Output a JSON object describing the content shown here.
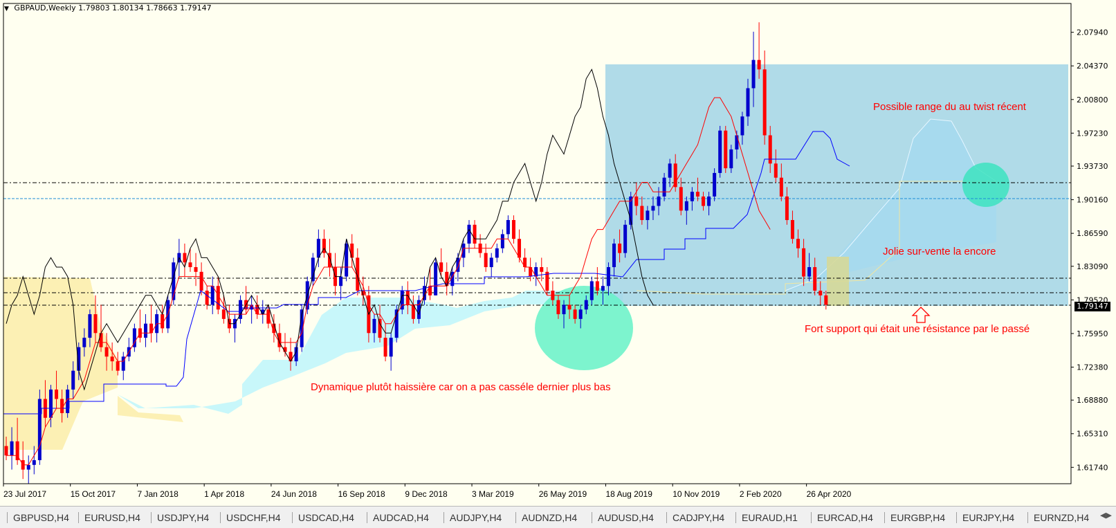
{
  "title": {
    "symbol": "GBPAUD,Weekly",
    "ohlc": "1.79803 1.80134 1.78663 1.79147"
  },
  "current_price": "1.79147",
  "price_axis": {
    "labels": [
      "2.07940",
      "2.04370",
      "2.00800",
      "1.97230",
      "1.93730",
      "1.90160",
      "1.86590",
      "1.83090",
      "1.79520",
      "1.75950",
      "1.72380",
      "1.68880",
      "1.65310",
      "1.61740"
    ],
    "ylim": [
      1.6,
      2.11
    ]
  },
  "time_axis": {
    "labels": [
      "23 Jul 2017",
      "15 Oct 2017",
      "7 Jan 2018",
      "1 Apr 2018",
      "24 Jun 2018",
      "16 Sep 2018",
      "9 Dec 2018",
      "3 Mar 2019",
      "26 May 2019",
      "18 Aug 2019",
      "10 Nov 2019",
      "2 Feb 2020",
      "26 Apr 2020"
    ],
    "label_bar_index": [
      0,
      12,
      24,
      36,
      48,
      60,
      72,
      84,
      96,
      108,
      120,
      132,
      144
    ]
  },
  "annotations": {
    "range_twist": "Possible range du au twist récent",
    "oversold": "Jolie sur-vente la encore",
    "support": "Fort support qui était une résistance par le passé",
    "dynamic": "Dynamique plutôt haissière car on a pas casséle dernier plus bas"
  },
  "chart_data": {
    "type": "candlestick",
    "ylim": [
      1.6,
      2.11
    ],
    "candles_ohlc": [
      [
        1.64,
        1.65,
        1.625,
        1.63
      ],
      [
        1.63,
        1.66,
        1.615,
        1.645
      ],
      [
        1.645,
        1.67,
        1.62,
        1.625
      ],
      [
        1.625,
        1.645,
        1.605,
        1.615
      ],
      [
        1.615,
        1.63,
        1.6,
        1.62
      ],
      [
        1.62,
        1.64,
        1.61,
        1.625
      ],
      [
        1.625,
        1.7,
        1.62,
        1.69
      ],
      [
        1.69,
        1.71,
        1.66,
        1.67
      ],
      [
        1.67,
        1.705,
        1.66,
        1.7
      ],
      [
        1.7,
        1.72,
        1.68,
        1.69
      ],
      [
        1.69,
        1.7,
        1.665,
        1.675
      ],
      [
        1.675,
        1.705,
        1.67,
        1.7
      ],
      [
        1.7,
        1.73,
        1.69,
        1.72
      ],
      [
        1.72,
        1.75,
        1.71,
        1.745
      ],
      [
        1.745,
        1.765,
        1.735,
        1.755
      ],
      [
        1.755,
        1.785,
        1.745,
        1.78
      ],
      [
        1.78,
        1.8,
        1.75,
        1.76
      ],
      [
        1.76,
        1.79,
        1.74,
        1.745
      ],
      [
        1.745,
        1.76,
        1.72,
        1.735
      ],
      [
        1.735,
        1.75,
        1.72,
        1.73
      ],
      [
        1.73,
        1.74,
        1.715,
        1.72
      ],
      [
        1.72,
        1.74,
        1.71,
        1.735
      ],
      [
        1.735,
        1.755,
        1.73,
        1.745
      ],
      [
        1.745,
        1.77,
        1.74,
        1.765
      ],
      [
        1.765,
        1.785,
        1.75,
        1.755
      ],
      [
        1.755,
        1.78,
        1.745,
        1.77
      ],
      [
        1.77,
        1.79,
        1.75,
        1.76
      ],
      [
        1.76,
        1.785,
        1.75,
        1.78
      ],
      [
        1.78,
        1.79,
        1.76,
        1.765
      ],
      [
        1.765,
        1.8,
        1.76,
        1.795
      ],
      [
        1.795,
        1.84,
        1.79,
        1.835
      ],
      [
        1.835,
        1.86,
        1.82,
        1.845
      ],
      [
        1.845,
        1.855,
        1.82,
        1.835
      ],
      [
        1.835,
        1.85,
        1.825,
        1.83
      ],
      [
        1.83,
        1.845,
        1.81,
        1.825
      ],
      [
        1.825,
        1.835,
        1.8,
        1.805
      ],
      [
        1.805,
        1.81,
        1.785,
        1.79
      ],
      [
        1.79,
        1.82,
        1.78,
        1.81
      ],
      [
        1.81,
        1.82,
        1.78,
        1.785
      ],
      [
        1.785,
        1.8,
        1.77,
        1.775
      ],
      [
        1.775,
        1.79,
        1.76,
        1.765
      ],
      [
        1.765,
        1.78,
        1.75,
        1.775
      ],
      [
        1.775,
        1.8,
        1.77,
        1.795
      ],
      [
        1.795,
        1.81,
        1.78,
        1.785
      ],
      [
        1.785,
        1.8,
        1.77,
        1.79
      ],
      [
        1.79,
        1.8,
        1.775,
        1.78
      ],
      [
        1.78,
        1.795,
        1.77,
        1.785
      ],
      [
        1.785,
        1.79,
        1.765,
        1.77
      ],
      [
        1.77,
        1.78,
        1.75,
        1.76
      ],
      [
        1.76,
        1.77,
        1.74,
        1.745
      ],
      [
        1.745,
        1.76,
        1.735,
        1.74
      ],
      [
        1.74,
        1.755,
        1.72,
        1.73
      ],
      [
        1.73,
        1.75,
        1.725,
        1.745
      ],
      [
        1.745,
        1.79,
        1.74,
        1.785
      ],
      [
        1.785,
        1.82,
        1.78,
        1.815
      ],
      [
        1.815,
        1.845,
        1.81,
        1.84
      ],
      [
        1.84,
        1.87,
        1.83,
        1.86
      ],
      [
        1.86,
        1.87,
        1.84,
        1.845
      ],
      [
        1.845,
        1.86,
        1.82,
        1.83
      ],
      [
        1.83,
        1.845,
        1.8,
        1.81
      ],
      [
        1.81,
        1.83,
        1.795,
        1.82
      ],
      [
        1.82,
        1.86,
        1.815,
        1.855
      ],
      [
        1.855,
        1.865,
        1.83,
        1.84
      ],
      [
        1.84,
        1.85,
        1.8,
        1.805
      ],
      [
        1.805,
        1.82,
        1.79,
        1.8
      ],
      [
        1.8,
        1.81,
        1.75,
        1.76
      ],
      [
        1.76,
        1.78,
        1.75,
        1.775
      ],
      [
        1.775,
        1.79,
        1.75,
        1.755
      ],
      [
        1.755,
        1.77,
        1.73,
        1.735
      ],
      [
        1.735,
        1.76,
        1.72,
        1.755
      ],
      [
        1.755,
        1.79,
        1.75,
        1.785
      ],
      [
        1.785,
        1.81,
        1.78,
        1.805
      ],
      [
        1.805,
        1.815,
        1.78,
        1.79
      ],
      [
        1.79,
        1.8,
        1.77,
        1.775
      ],
      [
        1.775,
        1.8,
        1.77,
        1.795
      ],
      [
        1.795,
        1.82,
        1.79,
        1.81
      ],
      [
        1.81,
        1.83,
        1.795,
        1.8
      ],
      [
        1.8,
        1.84,
        1.8,
        1.835
      ],
      [
        1.835,
        1.85,
        1.82,
        1.825
      ],
      [
        1.825,
        1.835,
        1.8,
        1.81
      ],
      [
        1.81,
        1.83,
        1.8,
        1.825
      ],
      [
        1.825,
        1.845,
        1.815,
        1.84
      ],
      [
        1.84,
        1.86,
        1.83,
        1.855
      ],
      [
        1.855,
        1.88,
        1.845,
        1.875
      ],
      [
        1.875,
        1.88,
        1.85,
        1.855
      ],
      [
        1.855,
        1.865,
        1.84,
        1.845
      ],
      [
        1.845,
        1.855,
        1.825,
        1.83
      ],
      [
        1.83,
        1.845,
        1.82,
        1.84
      ],
      [
        1.84,
        1.855,
        1.835,
        1.85
      ],
      [
        1.85,
        1.87,
        1.845,
        1.865
      ],
      [
        1.865,
        1.885,
        1.86,
        1.88
      ],
      [
        1.88,
        1.885,
        1.855,
        1.86
      ],
      [
        1.86,
        1.87,
        1.835,
        1.84
      ],
      [
        1.84,
        1.85,
        1.825,
        1.83
      ],
      [
        1.83,
        1.84,
        1.815,
        1.82
      ],
      [
        1.82,
        1.835,
        1.81,
        1.83
      ],
      [
        1.83,
        1.84,
        1.815,
        1.825
      ],
      [
        1.825,
        1.83,
        1.8,
        1.805
      ],
      [
        1.805,
        1.815,
        1.79,
        1.795
      ],
      [
        1.795,
        1.8,
        1.775,
        1.78
      ],
      [
        1.78,
        1.795,
        1.765,
        1.79
      ],
      [
        1.79,
        1.8,
        1.775,
        1.785
      ],
      [
        1.785,
        1.79,
        1.77,
        1.775
      ],
      [
        1.775,
        1.79,
        1.765,
        1.785
      ],
      [
        1.785,
        1.8,
        1.78,
        1.795
      ],
      [
        1.795,
        1.82,
        1.79,
        1.815
      ],
      [
        1.815,
        1.83,
        1.8,
        1.805
      ],
      [
        1.805,
        1.82,
        1.79,
        1.81
      ],
      [
        1.81,
        1.835,
        1.8,
        1.83
      ],
      [
        1.83,
        1.86,
        1.82,
        1.855
      ],
      [
        1.855,
        1.87,
        1.835,
        1.845
      ],
      [
        1.845,
        1.88,
        1.84,
        1.875
      ],
      [
        1.875,
        1.91,
        1.87,
        1.905
      ],
      [
        1.905,
        1.92,
        1.885,
        1.895
      ],
      [
        1.895,
        1.905,
        1.875,
        1.88
      ],
      [
        1.88,
        1.895,
        1.87,
        1.89
      ],
      [
        1.89,
        1.905,
        1.88,
        1.895
      ],
      [
        1.895,
        1.915,
        1.885,
        1.905
      ],
      [
        1.905,
        1.93,
        1.9,
        1.925
      ],
      [
        1.925,
        1.945,
        1.915,
        1.94
      ],
      [
        1.94,
        1.95,
        1.91,
        1.915
      ],
      [
        1.915,
        1.925,
        1.885,
        1.89
      ],
      [
        1.89,
        1.905,
        1.875,
        1.9
      ],
      [
        1.9,
        1.915,
        1.89,
        1.91
      ],
      [
        1.91,
        1.925,
        1.9,
        1.905
      ],
      [
        1.905,
        1.91,
        1.89,
        1.895
      ],
      [
        1.895,
        1.91,
        1.885,
        1.905
      ],
      [
        1.905,
        1.935,
        1.9,
        1.93
      ],
      [
        1.93,
        1.98,
        1.925,
        1.975
      ],
      [
        1.975,
        1.98,
        1.93,
        1.935
      ],
      [
        1.935,
        1.96,
        1.93,
        1.955
      ],
      [
        1.955,
        1.975,
        1.945,
        1.97
      ],
      [
        1.97,
        1.995,
        1.96,
        1.99
      ],
      [
        1.99,
        2.03,
        1.98,
        2.02
      ],
      [
        2.02,
        2.08,
        2.0,
        2.05
      ],
      [
        2.05,
        2.09,
        2.03,
        2.04
      ],
      [
        2.04,
        2.06,
        1.96,
        1.97
      ],
      [
        1.97,
        1.98,
        1.93,
        1.94
      ],
      [
        1.94,
        1.955,
        1.92,
        1.925
      ],
      [
        1.925,
        1.94,
        1.9,
        1.905
      ],
      [
        1.905,
        1.915,
        1.875,
        1.88
      ],
      [
        1.88,
        1.89,
        1.855,
        1.86
      ],
      [
        1.86,
        1.87,
        1.84,
        1.85
      ],
      [
        1.85,
        1.86,
        1.81,
        1.82
      ],
      [
        1.82,
        1.845,
        1.815,
        1.83
      ],
      [
        1.83,
        1.84,
        1.8,
        1.805
      ],
      [
        1.805,
        1.815,
        1.79,
        1.8
      ],
      [
        1.8,
        1.805,
        1.785,
        1.79
      ]
    ],
    "moving_line_black": [
      1.77,
      1.79,
      1.8,
      1.82,
      1.8,
      1.78,
      1.8,
      1.83,
      1.84,
      1.83,
      1.83,
      1.82,
      1.79,
      1.72,
      1.7,
      1.72,
      1.74,
      1.76,
      1.77,
      1.76,
      1.75,
      1.76,
      1.77,
      1.78,
      1.79,
      1.8,
      1.8,
      1.79,
      1.78,
      1.8,
      1.82,
      1.84,
      1.83,
      1.85,
      1.86,
      1.84,
      1.84,
      1.83,
      1.82,
      1.8,
      1.77,
      1.77,
      1.78,
      1.79,
      1.8,
      1.79,
      1.78,
      1.79,
      1.77,
      1.75,
      1.74,
      1.73,
      1.74,
      1.78,
      1.8,
      1.82,
      1.84,
      1.85,
      1.84,
      1.82,
      1.82,
      1.86,
      1.84,
      1.82,
      1.8,
      1.78,
      1.79,
      1.77,
      1.76,
      1.76,
      1.78,
      1.8,
      1.8,
      1.79,
      1.78,
      1.8,
      1.83,
      1.84,
      1.82,
      1.81,
      1.83,
      1.84,
      1.86,
      1.87,
      1.86,
      1.86,
      1.86,
      1.87,
      1.88,
      1.9,
      1.9,
      1.92,
      1.93,
      1.94,
      1.92,
      1.9,
      1.92,
      1.95,
      1.97,
      1.96,
      1.95,
      1.97,
      1.99,
      2.0,
      2.03,
      2.04,
      2.02,
      1.99,
      1.97,
      1.94,
      1.92,
      1.9,
      1.88,
      1.85,
      1.82,
      1.8,
      1.79
    ],
    "tenkan_red": [
      1.63,
      1.63,
      1.63,
      1.62,
      1.62,
      1.63,
      1.64,
      1.66,
      1.67,
      1.68,
      1.68,
      1.69,
      1.69,
      1.7,
      1.71,
      1.73,
      1.75,
      1.75,
      1.75,
      1.74,
      1.73,
      1.73,
      1.74,
      1.75,
      1.76,
      1.76,
      1.76,
      1.77,
      1.77,
      1.78,
      1.8,
      1.82,
      1.82,
      1.82,
      1.82,
      1.82,
      1.81,
      1.81,
      1.8,
      1.79,
      1.78,
      1.78,
      1.78,
      1.78,
      1.79,
      1.78,
      1.78,
      1.78,
      1.76,
      1.75,
      1.75,
      1.75,
      1.75,
      1.76,
      1.79,
      1.81,
      1.82,
      1.83,
      1.83,
      1.83,
      1.83,
      1.83,
      1.83,
      1.82,
      1.81,
      1.79,
      1.78,
      1.78,
      1.77,
      1.77,
      1.78,
      1.79,
      1.79,
      1.79,
      1.79,
      1.8,
      1.81,
      1.81,
      1.81,
      1.81,
      1.82,
      1.83,
      1.85,
      1.85,
      1.85,
      1.85,
      1.85,
      1.85,
      1.86,
      1.86,
      1.86,
      1.85,
      1.84,
      1.83,
      1.83,
      1.82,
      1.81,
      1.8,
      1.8,
      1.8,
      1.8,
      1.8,
      1.81,
      1.82,
      1.84,
      1.86,
      1.87,
      1.87,
      1.88,
      1.89,
      1.9,
      1.9,
      1.9,
      1.91,
      1.92,
      1.92,
      1.91,
      1.91,
      1.91,
      1.91,
      1.92,
      1.93,
      1.94,
      1.95,
      1.96,
      1.98,
      2.0,
      2.01,
      2.01,
      2.0,
      1.99,
      1.97,
      1.95,
      1.93,
      1.91,
      1.89,
      1.88,
      1.87
    ]
  }
}
